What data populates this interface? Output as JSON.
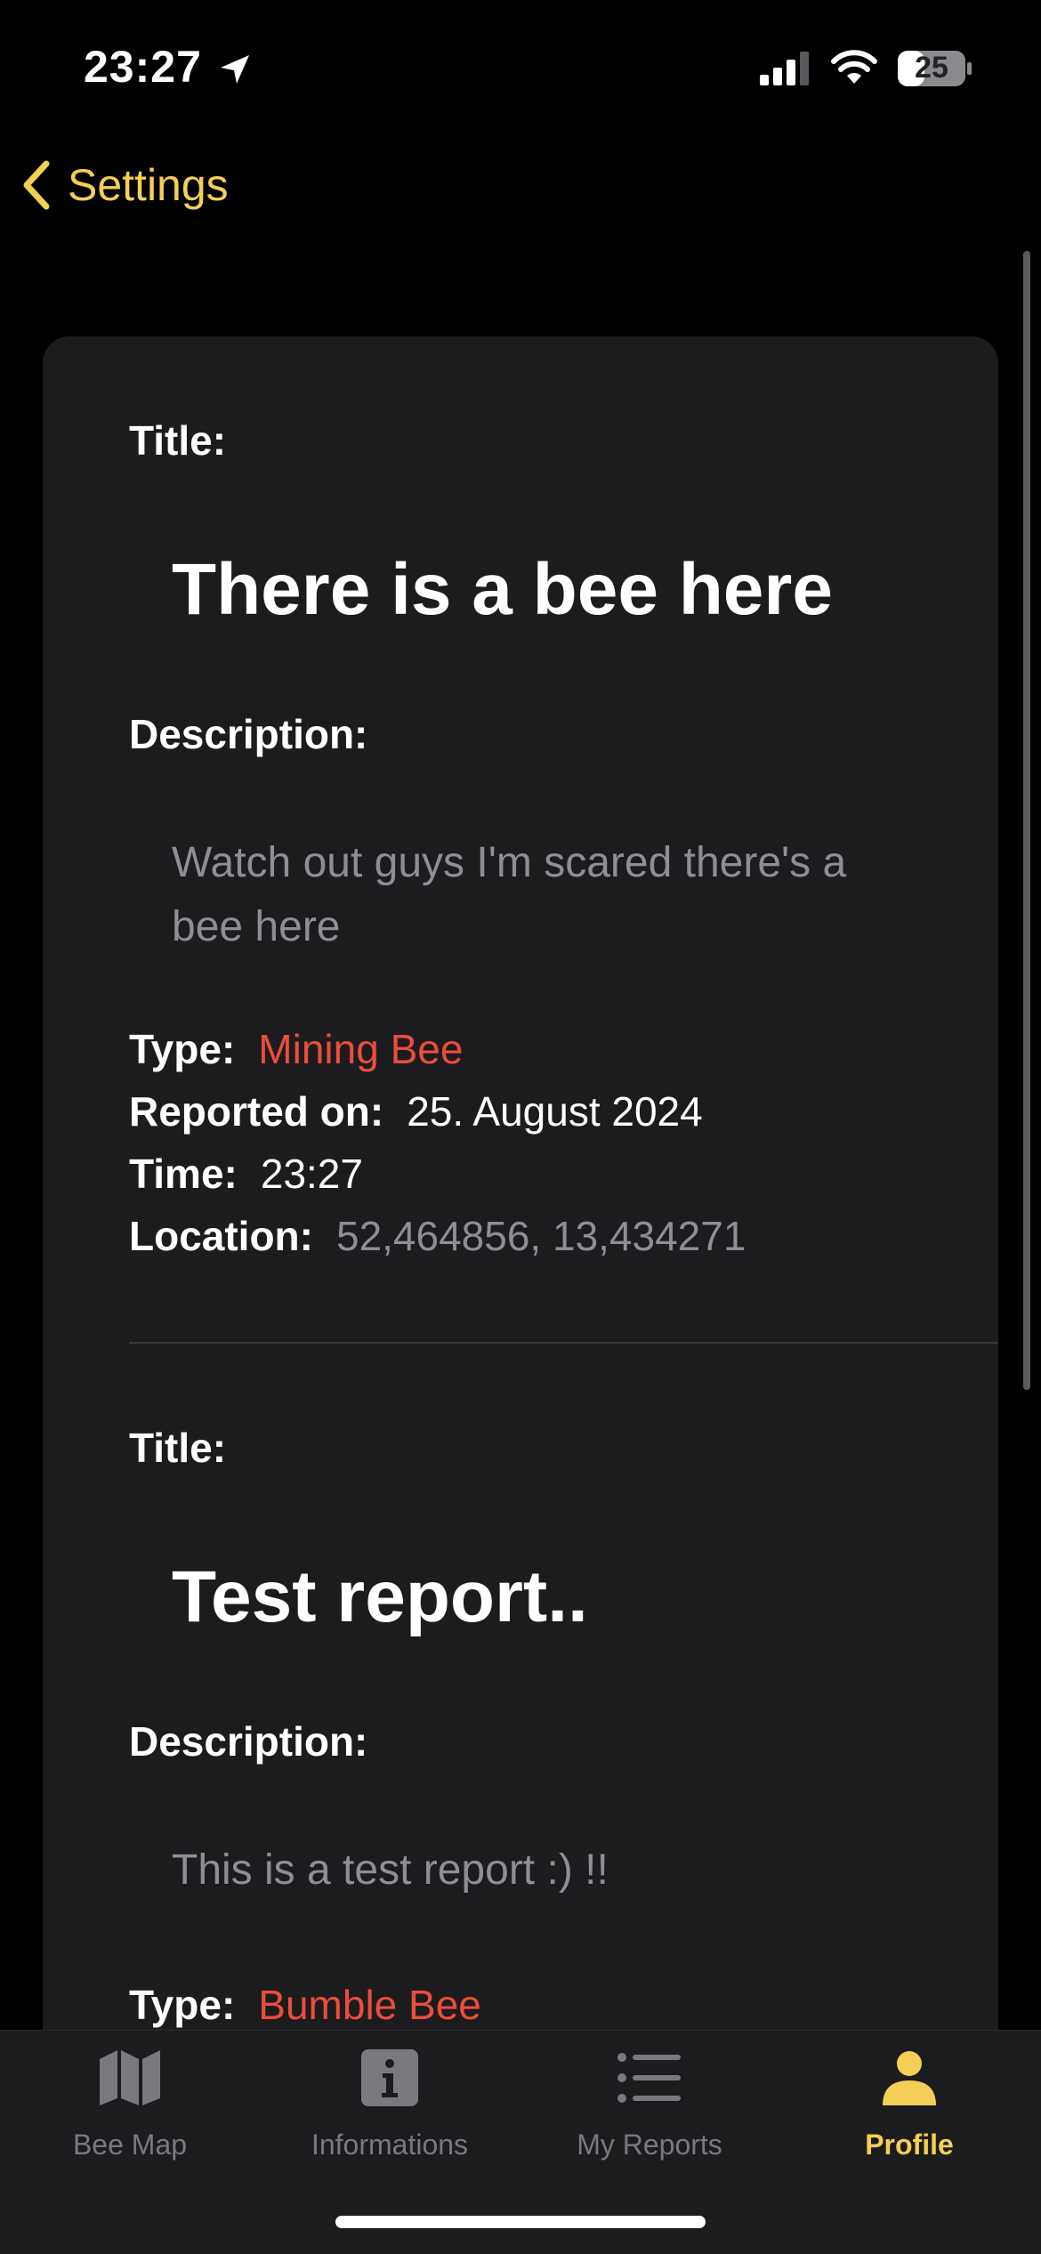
{
  "status_bar": {
    "time": "23:27",
    "battery": "25"
  },
  "nav": {
    "back_label": "Settings"
  },
  "reports": [
    {
      "title_label": "Title:",
      "title": "There is a bee here",
      "description_label": "Description:",
      "description": "Watch out guys I'm scared there's a bee here",
      "type_label": "Type:",
      "type": "Mining Bee",
      "reported_label": "Reported on:",
      "reported_on": "25. August 2024",
      "time_label": "Time:",
      "time": "23:27",
      "location_label": "Location:",
      "location": "52,464856, 13,434271"
    },
    {
      "title_label": "Title:",
      "title": "Test report..",
      "description_label": "Description:",
      "description": "This is a test report :) !!",
      "type_label": "Type:",
      "type": "Bumble Bee"
    }
  ],
  "tabs": [
    {
      "label": "Bee Map",
      "icon": "map-icon",
      "active": false
    },
    {
      "label": "Informations",
      "icon": "info-icon",
      "active": false
    },
    {
      "label": "My Reports",
      "icon": "list-icon",
      "active": false
    },
    {
      "label": "Profile",
      "icon": "person-icon",
      "active": true
    }
  ],
  "colors": {
    "accent": "#F5CF55",
    "type": "#EB4D3D",
    "card": "#1C1C1E",
    "muted": "#8E8E93"
  }
}
